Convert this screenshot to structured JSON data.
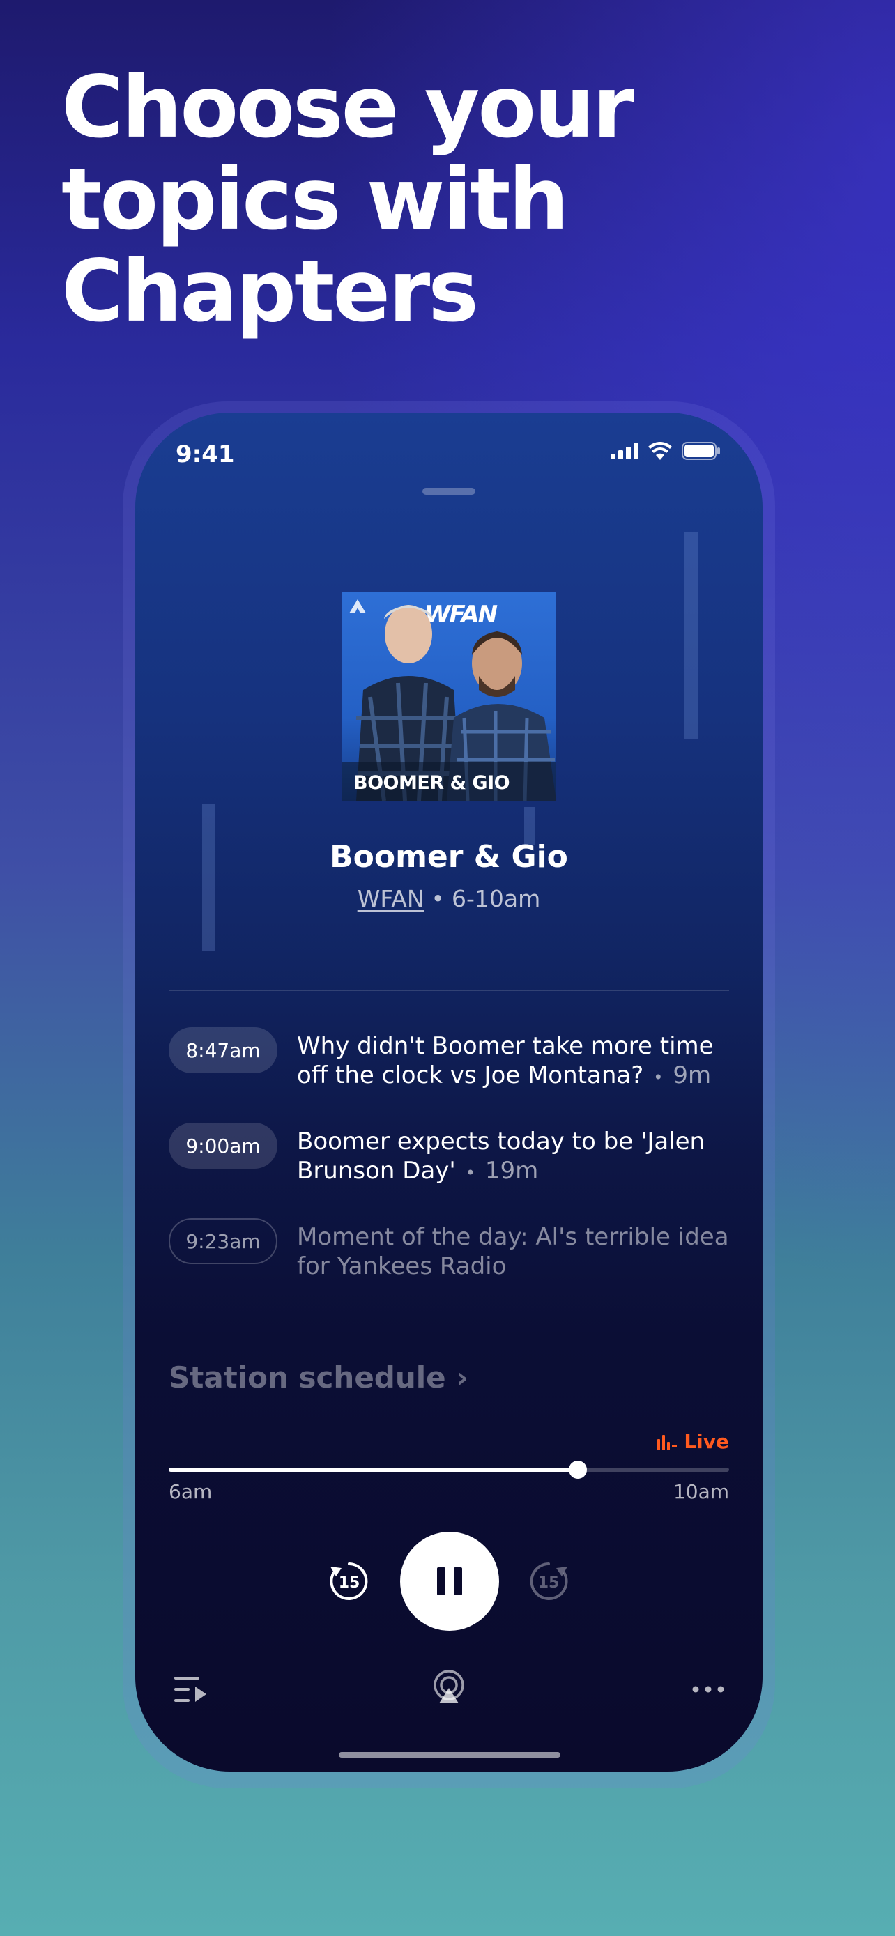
{
  "headline": {
    "line1": "Choose your",
    "line2": "topics with",
    "line3": "Chapters"
  },
  "status_bar": {
    "time": "9:41"
  },
  "artwork": {
    "caption": "BOOMER & GIO",
    "logo_text": "WFAN"
  },
  "show": {
    "title": "Boomer & Gio",
    "station": "WFAN",
    "separator": "•",
    "hours": "6-10am"
  },
  "chapters": [
    {
      "time": "8:47am",
      "title": "Why didn't Boomer take more time off the clock vs Joe Montana?",
      "duration": "9m",
      "state": "played"
    },
    {
      "time": "9:00am",
      "title": "Boomer expects today to be 'Jalen Brunson Day'",
      "duration": "19m",
      "state": "played"
    },
    {
      "time": "9:23am",
      "title": "Moment of the day: Al's terrible idea for Yankees Radio",
      "duration": "",
      "state": "upcoming"
    }
  ],
  "schedule_link": "Station schedule ›",
  "player": {
    "live_label": "Live",
    "start_label": "6am",
    "end_label": "10am",
    "progress_fraction": 0.73,
    "skip_back_seconds": "15",
    "skip_forward_seconds": "15"
  },
  "colors": {
    "live": "#ff5a1f",
    "phone_top": "#1a3d92",
    "phone_bottom": "#0a0a2c"
  },
  "icons": [
    "signal-icon",
    "wifi-icon",
    "battery-icon",
    "skip-back-15-icon",
    "pause-icon",
    "skip-forward-15-icon",
    "queue-icon",
    "airplay-icon",
    "more-icon",
    "live-bars-icon"
  ]
}
